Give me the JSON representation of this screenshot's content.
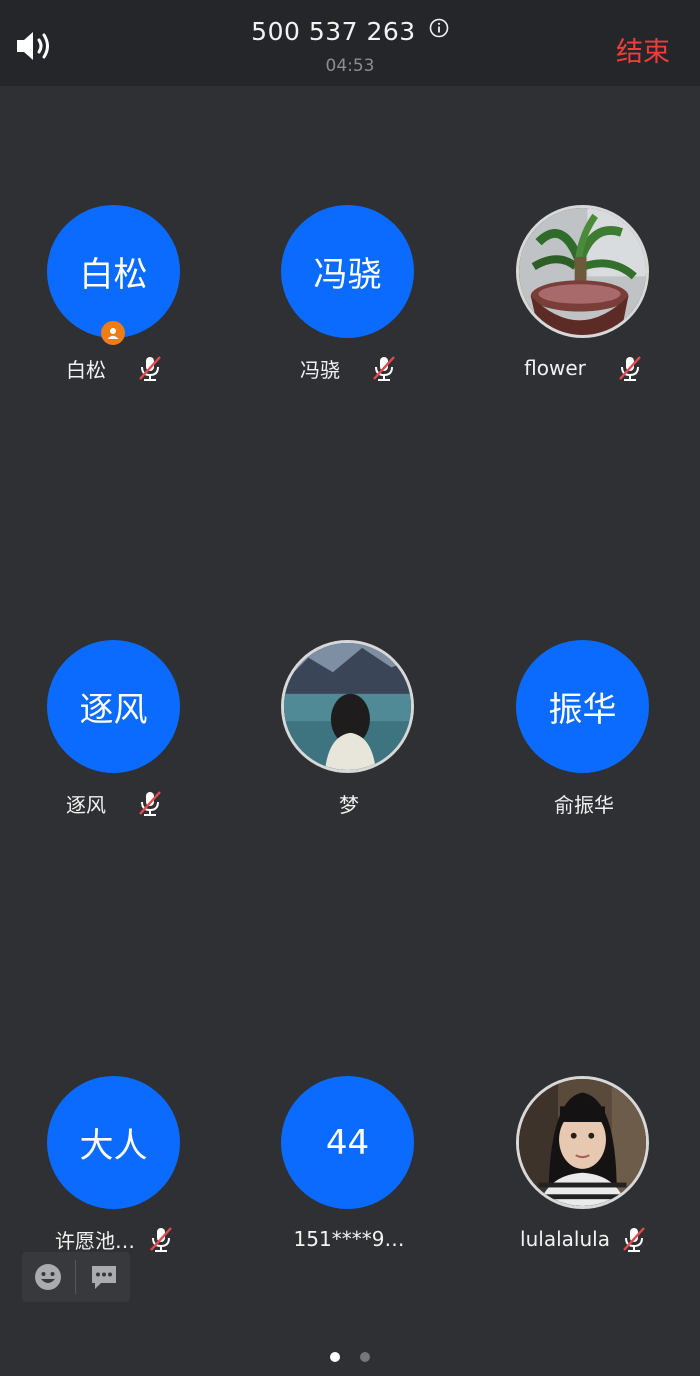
{
  "header": {
    "meeting_id": "500 537 263",
    "timer": "04:53",
    "end_label": "结束",
    "end_color": "#f23c3c"
  },
  "participants": [
    {
      "avatar_text": "白松",
      "name": "白松",
      "muted": true,
      "host": true
    },
    {
      "avatar_text": "冯骁",
      "name": "冯骁",
      "muted": true,
      "host": false
    },
    {
      "avatar_image": "potted-plant-photo",
      "name": "flower",
      "muted": true,
      "host": false
    },
    {
      "avatar_text": "逐风",
      "name": "逐风",
      "muted": true,
      "host": false
    },
    {
      "avatar_image": "girl-by-lake-photo",
      "name": "梦",
      "muted": false,
      "host": false
    },
    {
      "avatar_text": "振华",
      "name": "俞振华",
      "muted": false,
      "host": false
    },
    {
      "avatar_text": "大人",
      "name": "许愿池…",
      "muted": true,
      "host": false
    },
    {
      "avatar_text": "44",
      "name": "151****9…",
      "muted": false,
      "host": false
    },
    {
      "avatar_image": "girl-portrait-photo",
      "name": "lulalalula",
      "muted": true,
      "host": false
    }
  ],
  "toolbar": {
    "emoji_icon": "smiley-icon",
    "chat_icon": "chat-bubble-icon"
  },
  "pagination": {
    "pages": 2,
    "current": 1
  },
  "colors": {
    "accent": "#0b6bfe",
    "background": "#2e3034",
    "header": "#252629",
    "mute_slash": "#e5484d",
    "host_badge": "#f07c12"
  }
}
